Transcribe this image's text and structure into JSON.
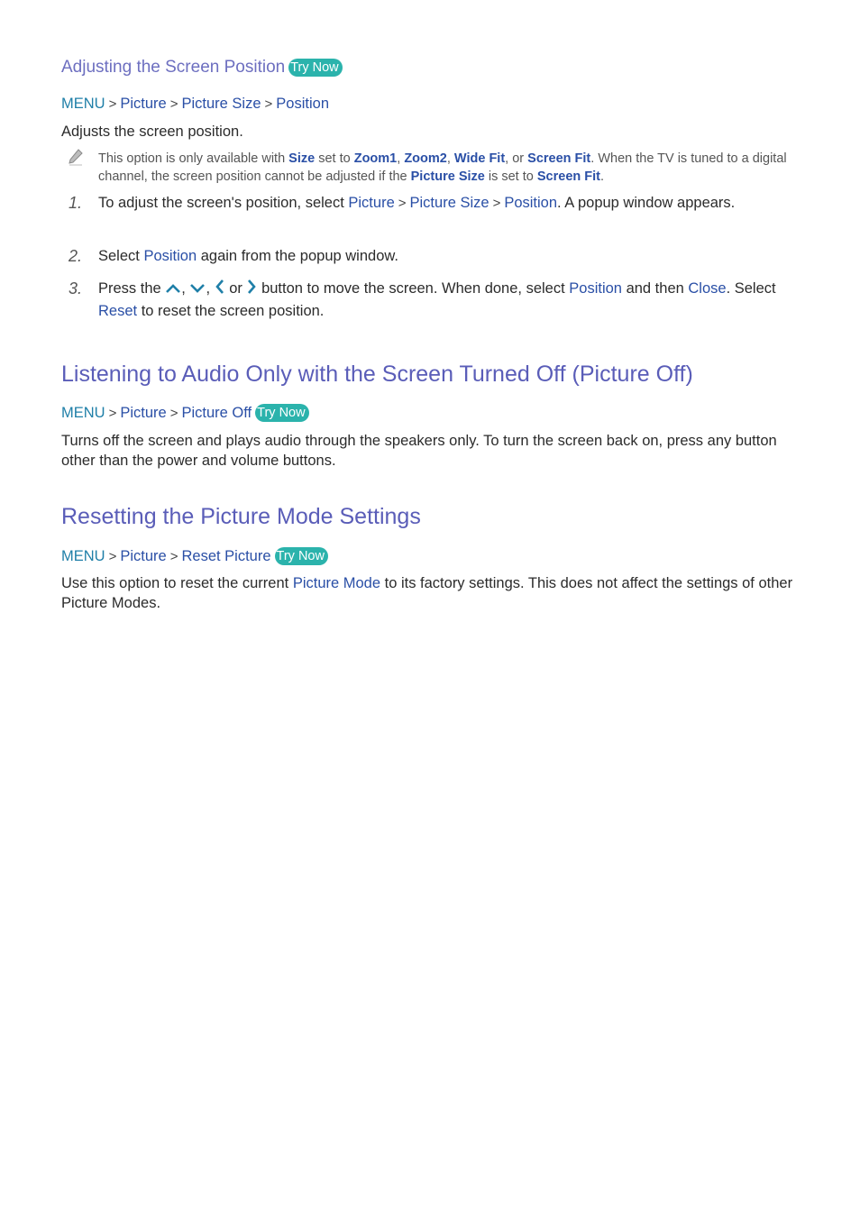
{
  "section1": {
    "heading": "Adjusting the Screen Position",
    "try_now": "Try Now",
    "path": {
      "menu": "MENU",
      "items": [
        "Picture",
        "Picture Size",
        "Position"
      ]
    },
    "description": "Adjusts the screen position.",
    "note": {
      "icon": "pencil-icon",
      "t1": "This option is only available with ",
      "k1": "Size",
      "t2": " set to ",
      "k2": "Zoom1",
      "t3": ", ",
      "k3": "Zoom2",
      "t4": ", ",
      "k4": "Wide Fit",
      "t5": ", or ",
      "k5": "Screen Fit",
      "t6": ". When the TV is tuned to a digital channel, the screen position cannot be adjusted if the ",
      "k6": "Picture Size",
      "t7": " is set to ",
      "k7": "Screen Fit",
      "t8": "."
    },
    "steps": [
      {
        "num": "1.",
        "t1": "To adjust the screen's position, select ",
        "k1": "Picture",
        "k2": "Picture Size",
        "k3": "Position",
        "t2": ". A popup window appears."
      },
      {
        "num": "2.",
        "t1": "Select ",
        "k1": "Position",
        "t2": " again from the popup window."
      },
      {
        "num": "3.",
        "t1": "Press the ",
        "icons": [
          "chevron-up-icon",
          "chevron-down-icon",
          "chevron-left-icon",
          "chevron-right-icon"
        ],
        "c1": ", ",
        "c2": ", ",
        "or": " or ",
        "t2": " button to move the screen. When done, select ",
        "k1": "Position",
        "t3": " and then ",
        "k2": "Close",
        "t4": ". Select ",
        "k3": "Reset",
        "t5": " to reset the screen position."
      }
    ]
  },
  "section2": {
    "heading": "Listening to Audio Only with the Screen Turned Off (Picture Off)",
    "try_now": "Try Now",
    "path": {
      "menu": "MENU",
      "items": [
        "Picture",
        "Picture Off"
      ]
    },
    "description": "Turns off the screen and plays audio through the speakers only. To turn the screen back on, press any button other than the power and volume buttons."
  },
  "section3": {
    "heading": "Resetting the Picture Mode Settings",
    "try_now": "Try Now",
    "path": {
      "menu": "MENU",
      "items": [
        "Picture",
        "Reset Picture"
      ]
    },
    "desc_t1": "Use this option to reset the current ",
    "desc_k1": "Picture Mode",
    "desc_t2": " to its factory settings. This does not affect the settings of other Picture Modes."
  },
  "colors": {
    "heading": "#5a5db8",
    "menu": "#1f7fa8",
    "link": "#2a4fa6",
    "badge": "#2bb3ac",
    "arrow_icon": "#1f7fa8"
  }
}
